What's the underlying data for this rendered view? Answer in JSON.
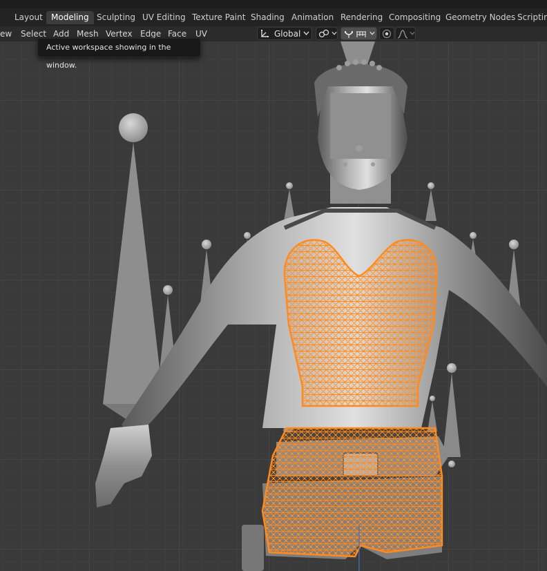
{
  "workspace_tabs": [
    {
      "label": "Layout"
    },
    {
      "label": "Modeling"
    },
    {
      "label": "Sculpting"
    },
    {
      "label": "UV Editing"
    },
    {
      "label": "Texture Paint"
    },
    {
      "label": "Shading"
    },
    {
      "label": "Animation"
    },
    {
      "label": "Rendering"
    },
    {
      "label": "Compositing"
    },
    {
      "label": "Geometry Nodes"
    },
    {
      "label": "Scripting"
    }
  ],
  "active_tab": "Modeling",
  "header_menu": [
    {
      "label": "ew"
    },
    {
      "label": "Select"
    },
    {
      "label": "Add"
    },
    {
      "label": "Mesh"
    },
    {
      "label": "Vertex"
    },
    {
      "label": "Edge"
    },
    {
      "label": "Face"
    },
    {
      "label": "UV"
    }
  ],
  "transform_orientation": {
    "value": "Global",
    "icon": "orientation-icon"
  },
  "header_icons": [
    "pivot-link-icon",
    "snap-magnet-icon",
    "snap-increment-icon",
    "proportional-edit-icon",
    "falloff-curve-icon"
  ],
  "tooltip": {
    "text": "Active workspace showing in the window."
  },
  "colors": {
    "selection": "#ff8a1f",
    "grid_bg": "#3a3a3a",
    "header_bg": "#2b2b2b",
    "active_tab_bg": "#3d3d3d"
  }
}
